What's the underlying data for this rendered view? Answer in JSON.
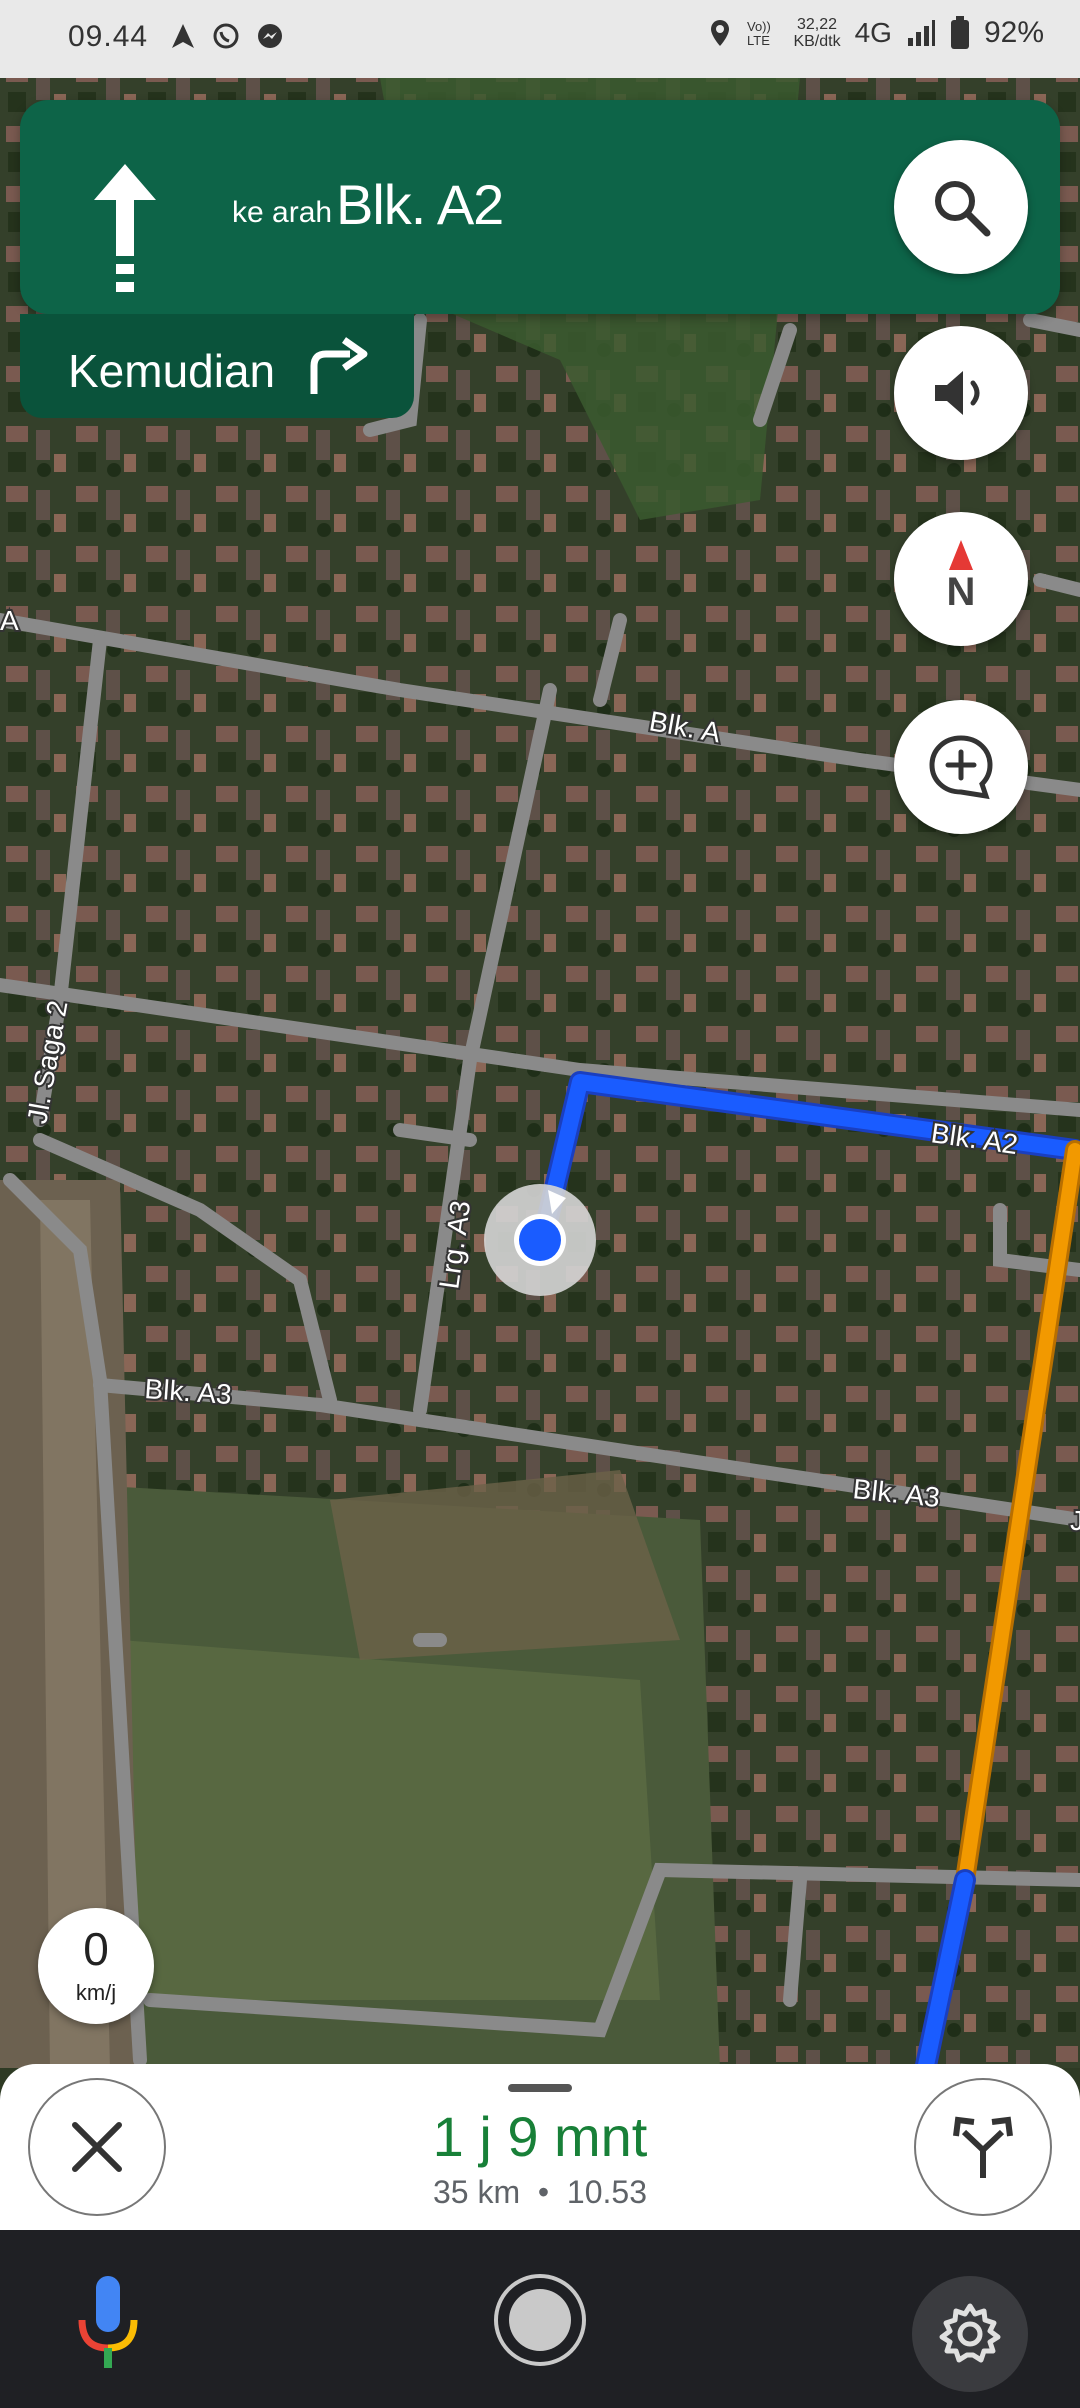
{
  "status_bar": {
    "time": "09.44",
    "net_speed": "32,22",
    "net_unit": "KB/dtk",
    "network": "4G",
    "battery": "92%"
  },
  "direction": {
    "toward_prefix": "ke arah",
    "street": "Blk. A2",
    "then_label": "Kemudian"
  },
  "map": {
    "road_labels": [
      "Blk. A",
      "Jl. Saga 2",
      "Blk. A2",
      "Lrg. A3",
      "Blk. A3",
      "Blk. A3",
      "A",
      "J"
    ],
    "compass_label": "N"
  },
  "speed": {
    "value": "0",
    "unit": "km/j"
  },
  "trip": {
    "eta_duration": "1 j 9 mnt",
    "distance": "35 km",
    "separator": "•",
    "arrival": "10.53"
  },
  "colors": {
    "card_green": "#0d6448",
    "route_blue": "#1a5cff",
    "traffic_orange": "#f29900",
    "eta_green": "#188038"
  }
}
